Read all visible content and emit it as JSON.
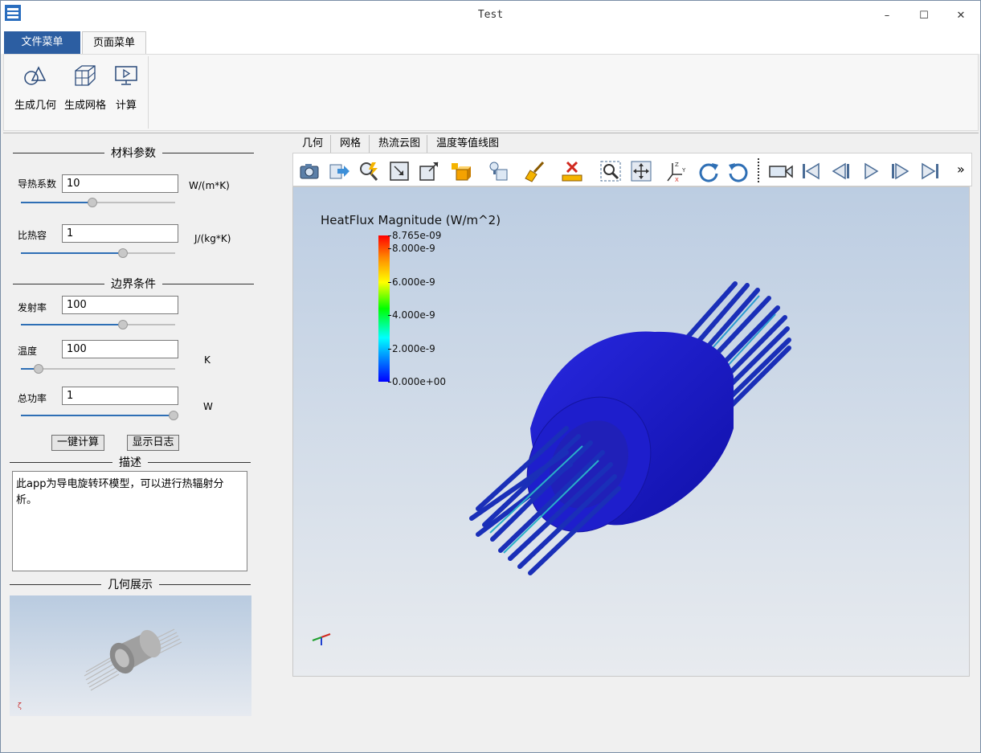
{
  "window": {
    "title": "Test",
    "minimize": "–",
    "maximize": "☐",
    "close": "✕"
  },
  "menu_tabs": [
    {
      "label": "文件菜单"
    },
    {
      "label": "页面菜单"
    }
  ],
  "ribbon": {
    "buttons": [
      {
        "label": "生成几何",
        "icon": "geometry-icon"
      },
      {
        "label": "生成网格",
        "icon": "mesh-icon"
      },
      {
        "label": "计算",
        "icon": "compute-icon"
      }
    ]
  },
  "left_panel": {
    "material": {
      "title": "材料参数",
      "fields": [
        {
          "label": "导热系数",
          "value": "10",
          "unit": "W/(m*K)",
          "slider_level": 0.46
        },
        {
          "label": "比热容",
          "value": "1",
          "unit": "J/(kg*K)",
          "slider_level": 0.67
        }
      ]
    },
    "boundary": {
      "title": "边界条件",
      "fields": [
        {
          "label": "发射率",
          "value": "100",
          "unit": "",
          "slider_level": 0.67
        },
        {
          "label": "温度",
          "value": "100",
          "unit": "K",
          "slider_level": 0.09
        },
        {
          "label": "总功率",
          "value": "1",
          "unit": "W",
          "slider_level": 1.0
        }
      ]
    },
    "buttons": {
      "compute": "一键计算",
      "log": "显示日志"
    },
    "description": {
      "title": "描述",
      "text": "此app为导电旋转环模型，可以进行热辐射分析。"
    },
    "geometry_preview": {
      "title": "几何展示"
    }
  },
  "view_tabs": [
    {
      "label": "几何"
    },
    {
      "label": "网格"
    },
    {
      "label": "热流云图"
    },
    {
      "label": "温度等值线图"
    }
  ],
  "toolbar": {
    "icons": [
      "camera-icon",
      "export-icon",
      "query-icon",
      "zoom-fit-icon",
      "zoom-region-icon",
      "display-mode-icon",
      "light-icon",
      "clear-icon",
      "ruler-icon",
      "zoom-box-icon",
      "pan-icon",
      "axes-icon",
      "rotate-cw-icon",
      "rotate-ccw-icon",
      "record-icon",
      "first-frame-icon",
      "prev-frame-icon",
      "play-icon",
      "next-frame-icon",
      "last-frame-icon"
    ],
    "more": "»"
  },
  "viewport": {
    "legend_title": "HeatFlux Magnitude (W/m^2)",
    "legend_ticks": [
      "8.765e-09",
      "8.000e-9",
      "6.000e-9",
      "4.000e-9",
      "2.000e-9",
      "0.000e+00"
    ],
    "colors": {
      "low": "#0000ff",
      "high": "#ff0000",
      "model": "#1a1acc"
    }
  }
}
